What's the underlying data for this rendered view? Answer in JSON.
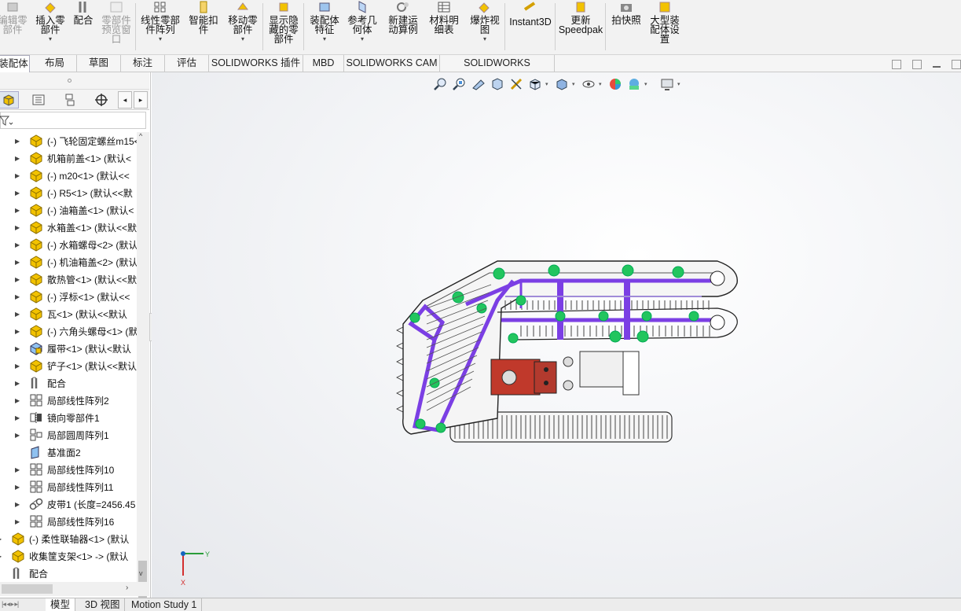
{
  "ribbon": {
    "buttons": [
      {
        "label": "编辑零\n部件",
        "disabled": true
      },
      {
        "label": "插入零\n部件"
      },
      {
        "label": "配合"
      },
      {
        "label": "零部件\n预览窗\n口",
        "disabled": true
      },
      {
        "label": "线性零部\n件阵列"
      },
      {
        "label": "智能扣\n件"
      },
      {
        "label": "移动零\n部件"
      },
      {
        "label": "显示隐\n藏的零\n部件"
      },
      {
        "label": "装配体\n特征"
      },
      {
        "label": "参考几\n何体"
      },
      {
        "label": "新建运\n动算例"
      },
      {
        "label": "材料明\n细表"
      },
      {
        "label": "爆炸视\n图"
      },
      {
        "label": "Instant3D"
      },
      {
        "label": "更新\nSpeedpak"
      },
      {
        "label": "拍快照"
      },
      {
        "label": "大型装\n配体设\n置"
      }
    ]
  },
  "tabs": [
    "装配体",
    "布局",
    "草图",
    "标注",
    "评估",
    "SOLIDWORKS 插件",
    "MBD",
    "SOLIDWORKS CAM",
    "SOLIDWORKS Inspection"
  ],
  "tree": {
    "items": [
      {
        "label": "(-) 飞轮固定螺丝m15<",
        "icon": "part-icon",
        "expand": "▶"
      },
      {
        "label": "机箱前盖<1> (默认<",
        "icon": "part-icon",
        "expand": "▶"
      },
      {
        "label": "(-) m20<1> (默认<<",
        "icon": "part-icon",
        "expand": "▶"
      },
      {
        "label": "(-) R5<1> (默认<<默",
        "icon": "part-icon",
        "expand": "▶"
      },
      {
        "label": "(-) 油箱盖<1> (默认<",
        "icon": "part-icon",
        "expand": "▶"
      },
      {
        "label": "水箱盖<1> (默认<<默",
        "icon": "part-icon",
        "expand": "▶"
      },
      {
        "label": "(-) 水箱螺母<2> (默认",
        "icon": "part-icon",
        "expand": "▶"
      },
      {
        "label": "(-) 机油箱盖<2> (默认",
        "icon": "part-icon",
        "expand": "▶"
      },
      {
        "label": "散热管<1> (默认<<默",
        "icon": "part-icon",
        "expand": "▶"
      },
      {
        "label": "(-) 浮标<1> (默认<<",
        "icon": "part-icon",
        "expand": "▶"
      },
      {
        "label": "瓦<1> (默认<<默认",
        "icon": "part-icon",
        "expand": "▶"
      },
      {
        "label": "(-) 六角头螺母<1> (默",
        "icon": "part-icon",
        "expand": "▶"
      },
      {
        "label": "履带<1> (默认<默认",
        "icon": "assembly-icon",
        "expand": "▶"
      },
      {
        "label": "铲子<1> (默认<<默认",
        "icon": "part-icon",
        "expand": "▶"
      },
      {
        "label": "配合",
        "icon": "mates-icon",
        "expand": "▶"
      },
      {
        "label": "局部线性阵列2",
        "icon": "pattern-icon",
        "expand": "▶"
      },
      {
        "label": "镜向零部件1",
        "icon": "mirror-icon",
        "expand": "▶"
      },
      {
        "label": "局部圆周阵列1",
        "icon": "circular-pattern-icon",
        "expand": "▶"
      },
      {
        "label": "基准面2",
        "icon": "plane-icon",
        "expand": ""
      },
      {
        "label": "局部线性阵列10",
        "icon": "pattern-icon",
        "expand": "▶"
      },
      {
        "label": "局部线性阵列11",
        "icon": "pattern-icon",
        "expand": "▶"
      },
      {
        "label": "皮带1 (长度=2456.45",
        "icon": "belt-icon",
        "expand": "▶"
      },
      {
        "label": "局部线性阵列16",
        "icon": "pattern-icon",
        "expand": "▶"
      },
      {
        "label": "(-) 柔性联轴器<1> (默认",
        "icon": "part-icon",
        "expand": "▶"
      },
      {
        "label": "收集筐支架<1> -> (默认",
        "icon": "part-icon",
        "expand": "▶"
      },
      {
        "label": "配合",
        "icon": "mates-icon",
        "expand": ""
      }
    ]
  },
  "bottom_tabs": [
    "模型",
    "3D 视图",
    "Motion Study 1"
  ],
  "triad": {
    "y_label": "Y",
    "x_label": "X"
  },
  "colors": {
    "accent": "#2a6ebb",
    "frame": "#7b3fe4",
    "sprocket": "#22c55e",
    "engine": "#c0392b"
  }
}
